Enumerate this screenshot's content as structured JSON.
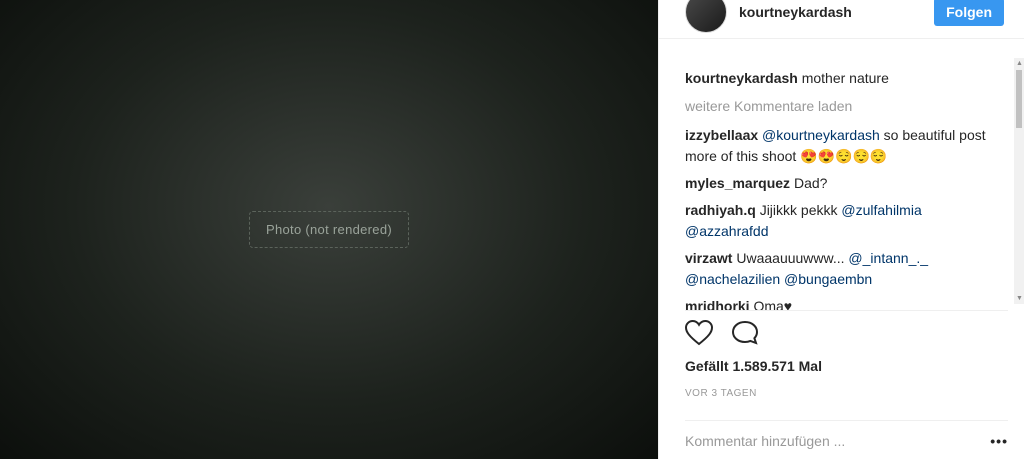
{
  "post": {
    "username": "kourtneykardash",
    "follow_label": "Folgen",
    "caption_user": "kourtneykardash",
    "caption_text": "mother nature",
    "load_more": "weitere Kommentare laden",
    "media_label": "Photo (not rendered)"
  },
  "comments": [
    {
      "user": "izzybellaax",
      "mention": "@kourtneykardash",
      "text": "so beautiful post more of this shoot 😍😍😌😌😌"
    },
    {
      "user": "myles_marquez",
      "mention": "",
      "text": "Dad?"
    },
    {
      "user": "radhiyah.q",
      "mention": "",
      "text": "Jijikkk pekkk",
      "mention2": "@zulfahilmia @azzahrafdd"
    },
    {
      "user": "virzawt",
      "mention": "",
      "text": "Uwaaauuuwww...",
      "mention2": "@_intann_._ @nachelazilien @bungaembn"
    },
    {
      "user": "mridhorki",
      "mention": "",
      "text": "Oma♥"
    }
  ],
  "stats": {
    "likes": "Gefällt 1.589.571 Mal",
    "time": "VOR 3 TAGEN"
  },
  "add_comment": {
    "placeholder": "Kommentar hinzufügen ...",
    "more": "•••"
  },
  "icons": [
    "heart-icon",
    "comment-icon"
  ]
}
